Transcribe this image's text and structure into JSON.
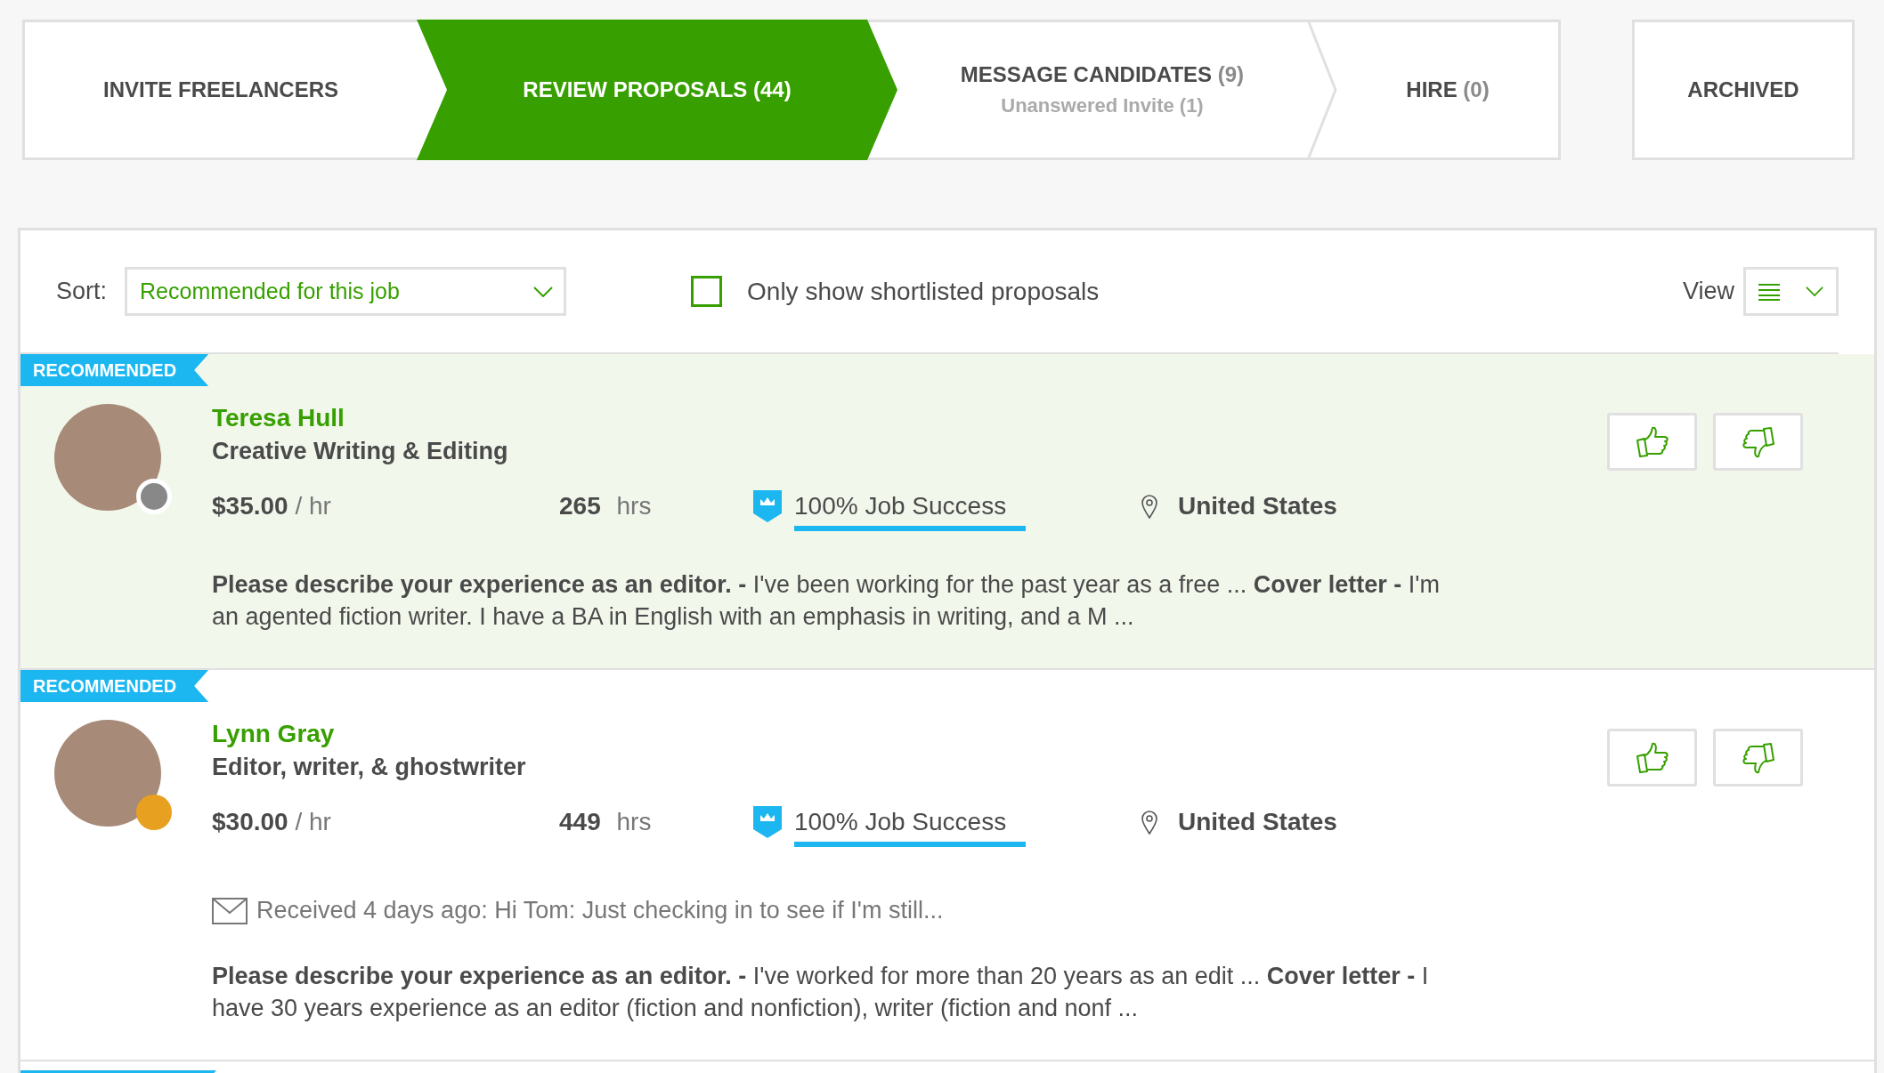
{
  "tabs": [
    {
      "label": "INVITE FREELANCERS",
      "selected": false
    },
    {
      "label": "REVIEW PROPOSALS",
      "count": "(44)",
      "selected": true
    },
    {
      "label": "MESSAGE CANDIDATES",
      "count": "(9)",
      "sublabel": "Unanswered Invite (1)",
      "selected": false
    },
    {
      "label": "HIRE",
      "count": "(0)",
      "selected": false
    }
  ],
  "archived_tab": {
    "label": "ARCHIVED"
  },
  "toolbar": {
    "sort_label": "Sort:",
    "sort_value": "Recommended for this job",
    "shortlist_checkbox": {
      "label": "Only show shortlisted proposals",
      "checked": false
    },
    "view_label": "View"
  },
  "proposals": [
    {
      "badge": "RECOMMENDED",
      "highlighted": true,
      "color": "#888888",
      "name": "Teresa Hull",
      "title": "Creative Writing & Editing",
      "rate": "$35.00",
      "rate_unit": "/ hr",
      "hours": "265",
      "hours_unit": "hrs",
      "job_success": "100% Job Success",
      "location": "United States",
      "answer": "**Please describe your experience as an editor. -** I've been working for the past year as a free ... **Cover letter -** I'm an agented fiction writer. I have a BA in English with an emphasis in writing, and a M ..."
    },
    {
      "badge": "RECOMMENDED",
      "highlighted": false,
      "color": "#e8a020",
      "name": "Lynn Gray",
      "title": "Editor, writer, & ghostwriter",
      "rate": "$30.00",
      "rate_unit": "/ hr",
      "hours": "449",
      "hours_unit": "hrs",
      "job_success": "100% Job Success",
      "location": "United States",
      "message": "Received 4 days ago: Hi Tom: Just checking in to see if I'm still...",
      "answer": "**Please describe your experience as an editor. -** I've worked for more than 20 years as an edit ... **Cover letter -** I have 30 years experience as an editor (fiction and nonfiction), writer (fiction and nonf ..."
    }
  ]
}
